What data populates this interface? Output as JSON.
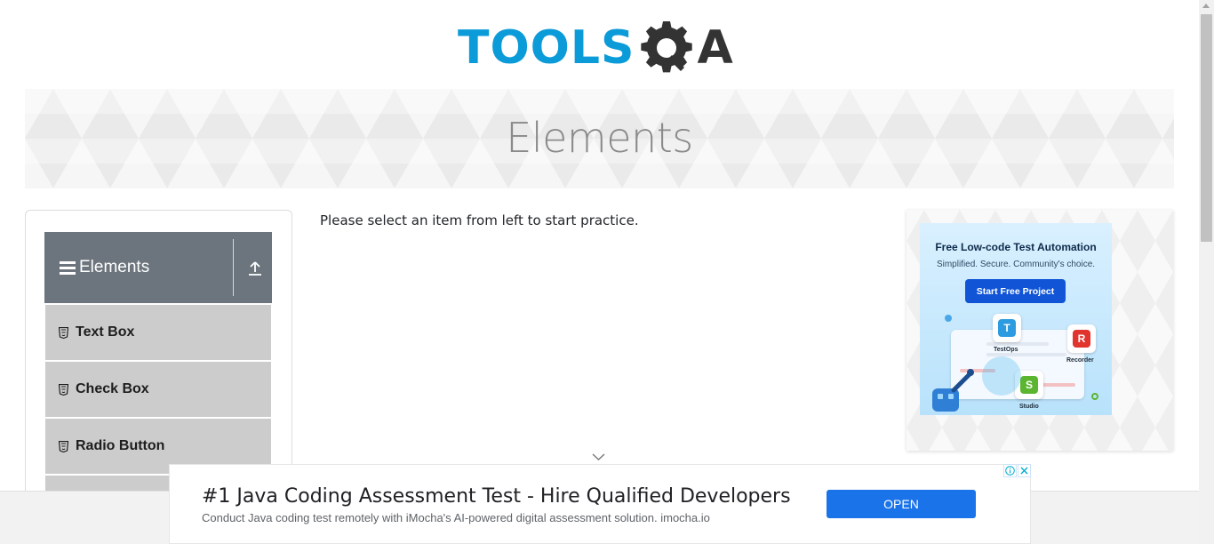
{
  "header": {
    "logo_tools": "TOOLS",
    "logo_qa": "A",
    "logo_alt": "TOOLSQA"
  },
  "banner": {
    "title": "Elements"
  },
  "sidebar": {
    "group_title": "Elements",
    "items": [
      {
        "label": "Text Box",
        "icon": "html5-icon"
      },
      {
        "label": "Check Box",
        "icon": "html5-icon"
      },
      {
        "label": "Radio Button",
        "icon": "html5-icon"
      },
      {
        "label": "",
        "icon": "html5-icon"
      }
    ]
  },
  "main": {
    "intro_text": "Please select an item from left to start practice."
  },
  "right_ad": {
    "headline": "Free Low-code Test Automation",
    "subtitle": "Simplified. Secure. Community's choice.",
    "cta_label": "Start Free Project",
    "tiles": [
      {
        "letter": "T",
        "label": "TestOps"
      },
      {
        "letter": "R",
        "label": "Recorder"
      },
      {
        "letter": "S",
        "label": "Studio"
      }
    ]
  },
  "bottom_ad": {
    "title": "#1 Java Coding Assessment Test - Hire Qualified Developers",
    "description": "Conduct Java coding test remotely with iMocha's AI-powered digital assessment solution. imocha.io",
    "open_label": "OPEN",
    "info_glyph": "i",
    "close_glyph": "✕"
  },
  "colors": {
    "brand_blue": "#0b9bd8",
    "brand_dark": "#333333",
    "group_header": "#6c757d",
    "menu_item": "#cccccc",
    "ad_button": "#1a73e8"
  }
}
